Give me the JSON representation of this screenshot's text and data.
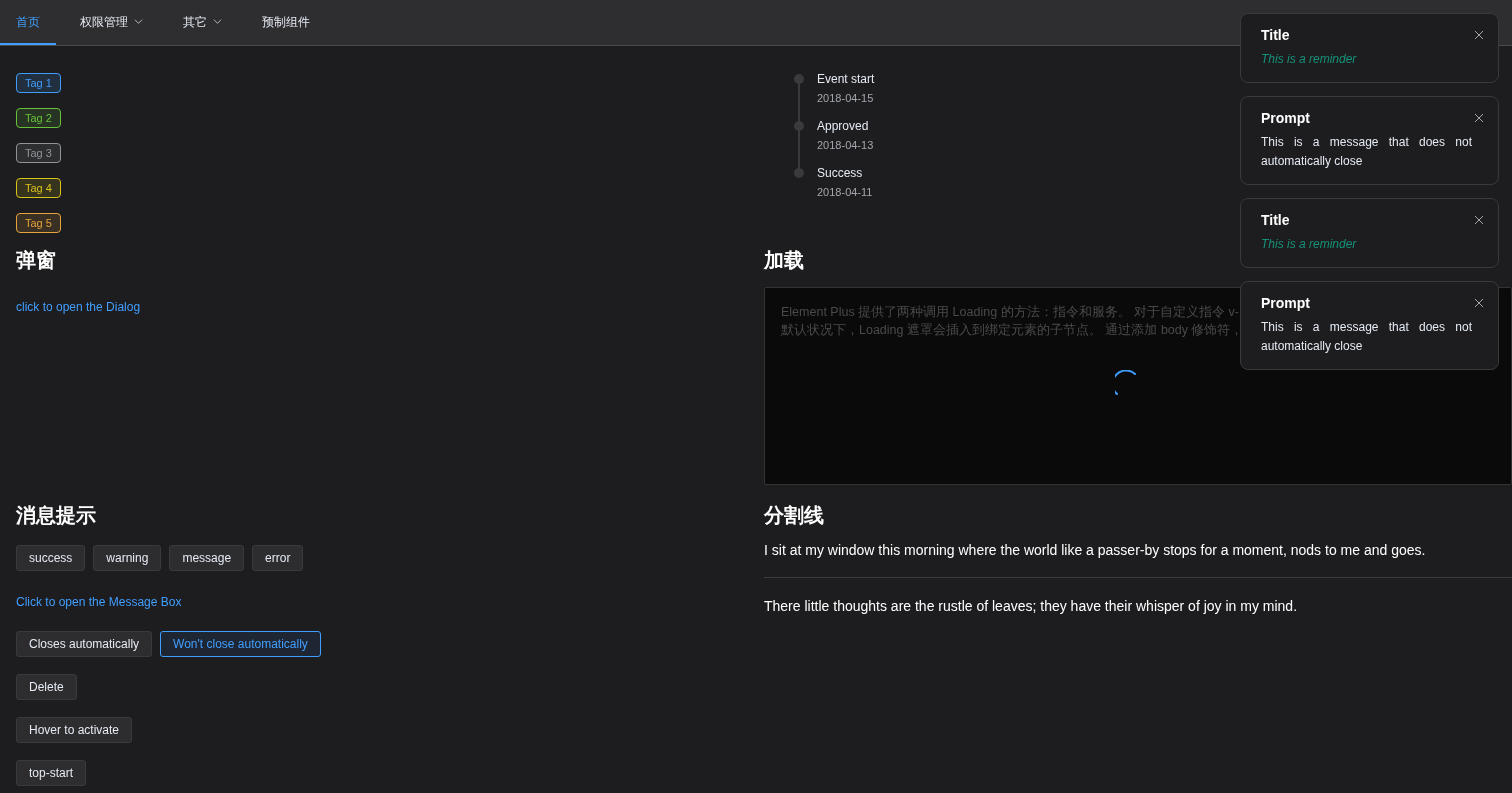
{
  "nav": {
    "items": [
      {
        "label": "首页",
        "selected": true,
        "dropdown": false
      },
      {
        "label": "权限管理",
        "selected": false,
        "dropdown": true
      },
      {
        "label": "其它",
        "selected": false,
        "dropdown": true
      },
      {
        "label": "预制组件",
        "selected": false,
        "dropdown": false
      }
    ]
  },
  "tags": {
    "items": [
      {
        "label": "Tag 1",
        "color": "#409eff"
      },
      {
        "label": "Tag 2",
        "color": "#67c23a"
      },
      {
        "label": "Tag 3",
        "color": "#909399"
      },
      {
        "label": "Tag 4",
        "color": "#d9c21a"
      },
      {
        "label": "Tag 5",
        "color": "#e6a23c"
      }
    ]
  },
  "dialog": {
    "heading": "弹窗",
    "link": "click to open the Dialog"
  },
  "messages": {
    "heading": "消息提示",
    "type_buttons": [
      {
        "label": "success",
        "focused": false
      },
      {
        "label": "warning",
        "focused": false
      },
      {
        "label": "message",
        "focused": false
      },
      {
        "label": "error",
        "focused": false
      }
    ],
    "link": "Click to open the Message Box",
    "button_rows": [
      [
        {
          "label": "Closes automatically",
          "focused": false
        },
        {
          "label": "Won't close automatically",
          "focused": true
        }
      ],
      [
        {
          "label": "Delete",
          "focused": false
        }
      ],
      [
        {
          "label": "Hover to activate",
          "focused": false
        }
      ],
      [
        {
          "label": "top-start",
          "focused": false
        }
      ]
    ]
  },
  "timeline": {
    "items": [
      {
        "title": "Event start",
        "date": "2018-04-15"
      },
      {
        "title": "Approved",
        "date": "2018-04-13"
      },
      {
        "title": "Success",
        "date": "2018-04-11"
      }
    ]
  },
  "loading": {
    "heading": "加载",
    "lines": [
      "Element Plus 提供了两种调用 Loading 的方法：指令和服务。 对于自定义指令 v-",
      "默认状况下，Loading 遮罩会插入到绑定元素的子节点。 通过添加 body 修饰符，"
    ]
  },
  "divider": {
    "heading": "分割线",
    "paragraphs": [
      "I sit at my window this morning where the world like a passer-by stops for a moment, nods to me and goes.",
      "There little thoughts are the rustle of leaves; they have their whisper of joy in my mind."
    ]
  },
  "notifications": [
    {
      "kind": "reminder",
      "title": "Title",
      "body": "This is a reminder"
    },
    {
      "kind": "message",
      "title": "Prompt",
      "body": "This is a message that does not automatically close"
    },
    {
      "kind": "reminder",
      "title": "Title",
      "body": "This is a reminder"
    },
    {
      "kind": "message",
      "title": "Prompt",
      "body": "This is a message that does not automatically close"
    }
  ]
}
